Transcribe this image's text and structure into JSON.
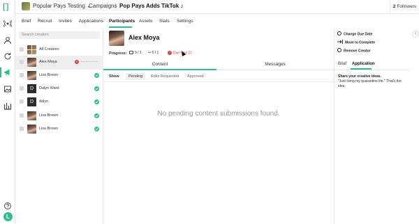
{
  "header": {
    "workspace": "Popular Pays Testing",
    "workspace_caret": "⌄",
    "separator": "/",
    "campaigns": "Campaigns",
    "campaign_name": "Pop Pays Adds TikTok",
    "campaign_platform_glyph": "♪",
    "followers_count": "2",
    "followers_label": "Followers"
  },
  "tabs": [
    "Brief",
    "Recruit",
    "Invites",
    "Applications",
    "Participants",
    "Assets",
    "Stats",
    "Settings"
  ],
  "active_tab": "Participants",
  "creator_list": {
    "search_placeholder": "Search creators",
    "items": [
      {
        "name": "All Creators",
        "avatar": "grid",
        "status": "none"
      },
      {
        "name": "Alex Moya",
        "avatar": "photo",
        "status": "pending",
        "badge": "!"
      },
      {
        "name": "Lisa Brown",
        "avatar": "photo",
        "status": "complete"
      },
      {
        "name": "Dalyn Ward",
        "avatar": "letter",
        "letter": "D",
        "status": "complete"
      },
      {
        "name": "dalyn",
        "avatar": "letter",
        "letter": "D",
        "status": "complete"
      },
      {
        "name": "Lisa Brown",
        "avatar": "photo",
        "status": "complete"
      },
      {
        "name": "Lisa Brown",
        "avatar": "photo",
        "status": "complete"
      }
    ]
  },
  "creator": {
    "name": "Alex Moya",
    "progress_label": "Progress:",
    "content_progress": "0 / 1",
    "link_progress": "0 / 1",
    "due_badge": "!",
    "due_text": "Due May 22"
  },
  "content_tabs": {
    "content": "Content",
    "messages": "Messages"
  },
  "filters": {
    "show_label": "Show",
    "options": [
      "Pending",
      "Edits Requested",
      "Approved"
    ],
    "active": "Pending"
  },
  "empty_state": "No pending content submissions found.",
  "actions": {
    "change_due_date": "Change Due Date",
    "move_to_complete": "Move to Complete",
    "remove_creator": "Remove Creator"
  },
  "side_tabs": {
    "brief": "Brief",
    "application": "Application"
  },
  "application": {
    "question": "Share your creative ideas.",
    "answer": "\"Just living my quarantine life.\" That's the idea."
  },
  "user_initial": "L",
  "colors": {
    "accent": "#2fbf8f",
    "alert": "#e04040"
  }
}
